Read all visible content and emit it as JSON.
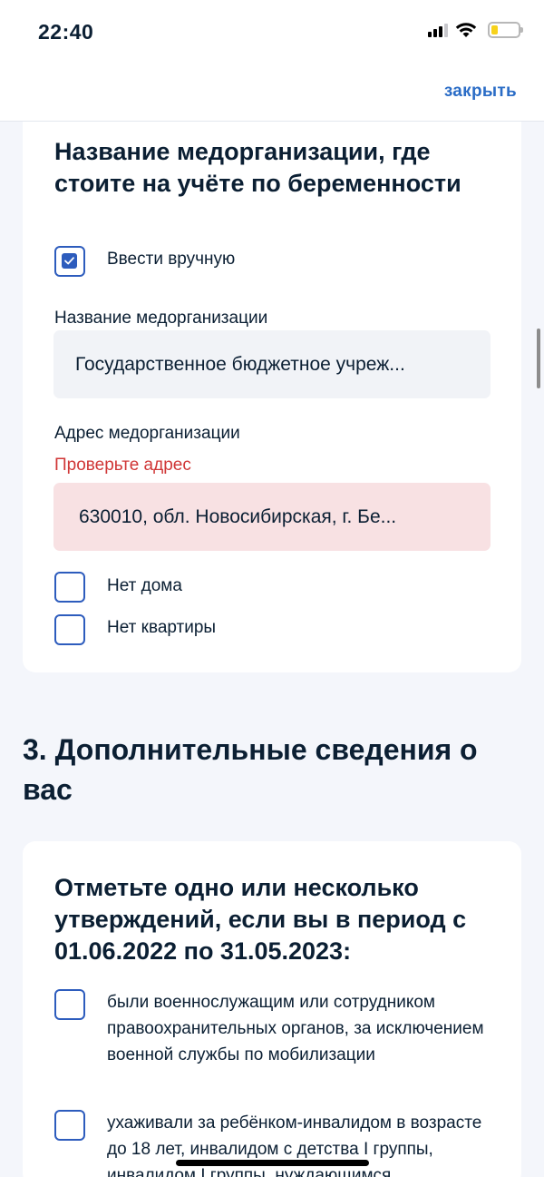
{
  "status_bar": {
    "time": "22:40",
    "icons": [
      "cellular-signal-icon",
      "wifi-icon",
      "battery-icon"
    ]
  },
  "header": {
    "close_label": "закрыть",
    "accent_color": "#2a6cc6"
  },
  "medorg_card": {
    "title": "Название медорганизации, где стоите на учёте по беременности",
    "manual_checkbox": {
      "label": "Ввести вручную",
      "checked": true
    },
    "name_field": {
      "label": "Название медорганизации",
      "value": "Государственное бюджетное учреж..."
    },
    "address_field": {
      "label": "Адрес медорганизации",
      "error": "Проверьте адрес",
      "value": "630010, обл. Новосибирская, г. Бе...",
      "error_color": "#d03737"
    },
    "no_house": {
      "label": "Нет дома",
      "checked": false
    },
    "no_apartment": {
      "label": "Нет квартиры",
      "checked": false
    }
  },
  "section3": {
    "title": "3. Дополнительные сведения о вас"
  },
  "statements_card": {
    "title": "Отметьте одно или несколько утверждений, если вы в период с 01.06.2022 по 31.05.2023:",
    "options": [
      {
        "label": "были военнослужащим или сотрудником правоохранительных органов, за исключением военной службы по мобилизации",
        "checked": false
      },
      {
        "label": "ухаживали за ребёнком-инвалидом в возрасте до 18 лет, инвалидом с детства I группы, инвалидом I группы, нуждающимся",
        "checked": false
      }
    ]
  }
}
